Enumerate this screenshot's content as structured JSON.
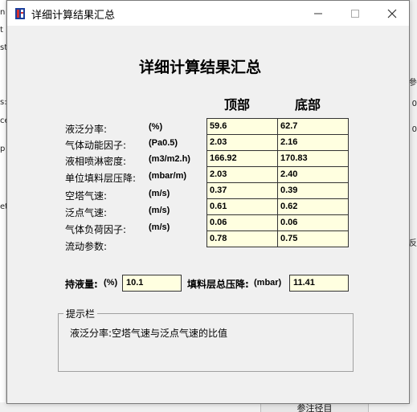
{
  "window": {
    "title": "详细计算结果汇总"
  },
  "heading": "详细计算结果汇总",
  "columns": {
    "top": "顶部",
    "bottom": "底部"
  },
  "rows": [
    {
      "label": "液泛分率:",
      "unit": "(%)",
      "top": "59.6",
      "bottom": "62.7"
    },
    {
      "label": "气体动能因子:",
      "unit": "(Pa0.5)",
      "top": "2.03",
      "bottom": "2.16"
    },
    {
      "label": "液相喷淋密度:",
      "unit": "(m3/m2.h)",
      "top": "166.92",
      "bottom": "170.83"
    },
    {
      "label": "单位填料层压降:",
      "unit": "(mbar/m)",
      "top": "2.03",
      "bottom": "2.40"
    },
    {
      "label": "空塔气速:",
      "unit": "(m/s)",
      "top": "0.37",
      "bottom": "0.39"
    },
    {
      "label": "泛点气速:",
      "unit": "(m/s)",
      "top": "0.61",
      "bottom": "0.62"
    },
    {
      "label": "气体负荷因子:",
      "unit": "(m/s)",
      "top": "0.06",
      "bottom": "0.06"
    },
    {
      "label": "流动参数:",
      "unit": "",
      "top": "0.78",
      "bottom": "0.75"
    }
  ],
  "summary": {
    "holdup_label": "持液量:",
    "holdup_unit": "(%)",
    "holdup_value": "10.1",
    "pressure_label": "填料层总压降:",
    "pressure_unit": "(mbar)",
    "pressure_value": "11.41"
  },
  "hint": {
    "legend": "提示栏",
    "text": "液泛分率:空塔气速与泛点气速的比值"
  },
  "background": {
    "left_chars": [
      "n",
      "t",
      "st",
      "s:",
      "ce",
      "p",
      "et"
    ],
    "right_chars": [
      "參",
      "0",
      "0",
      "反"
    ],
    "bottom_button": "参注径目"
  }
}
